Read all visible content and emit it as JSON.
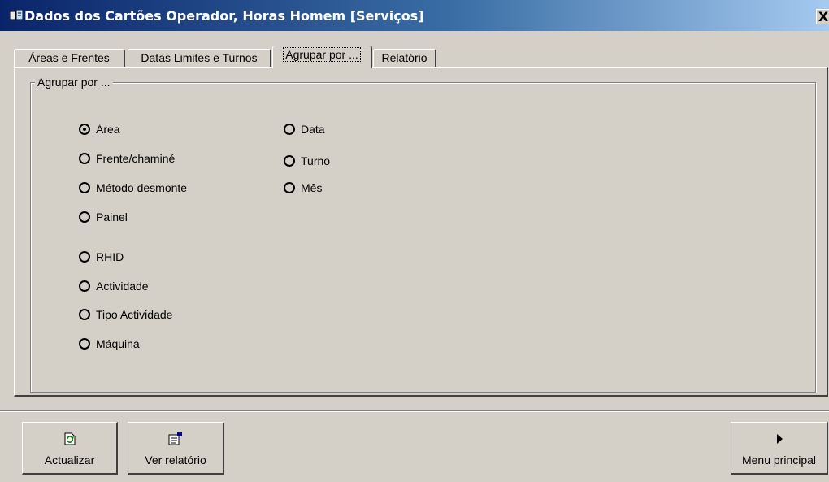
{
  "window": {
    "title": "Dados dos Cartões Operador, Horas Homem [Serviços]",
    "close_label": "X"
  },
  "tabs": [
    {
      "label": "Áreas e Frentes",
      "active": false
    },
    {
      "label": "Datas Limites e Turnos",
      "active": false
    },
    {
      "label": "Agrupar por ...",
      "active": true
    },
    {
      "label": "Relatório",
      "active": false
    }
  ],
  "group": {
    "label": "Agrupar por ...",
    "options_left": [
      {
        "label": "Área",
        "checked": true
      },
      {
        "label": "Frente/chaminé",
        "checked": false
      },
      {
        "label": "Método desmonte",
        "checked": false
      },
      {
        "label": "Painel",
        "checked": false
      },
      {
        "label": "RHID",
        "checked": false
      },
      {
        "label": "Actividade",
        "checked": false
      },
      {
        "label": "Tipo Actividade",
        "checked": false
      },
      {
        "label": "Máquina",
        "checked": false
      }
    ],
    "options_right": [
      {
        "label": "Data",
        "checked": false
      },
      {
        "label": "Turno",
        "checked": false
      },
      {
        "label": "Mês",
        "checked": false
      }
    ]
  },
  "buttons": {
    "refresh": {
      "label": "Actualizar",
      "icon": "refresh-icon"
    },
    "report": {
      "label": "Ver relatório",
      "icon": "report-icon"
    },
    "main_menu": {
      "label": "Menu principal",
      "icon": "play-arrow-icon"
    }
  }
}
